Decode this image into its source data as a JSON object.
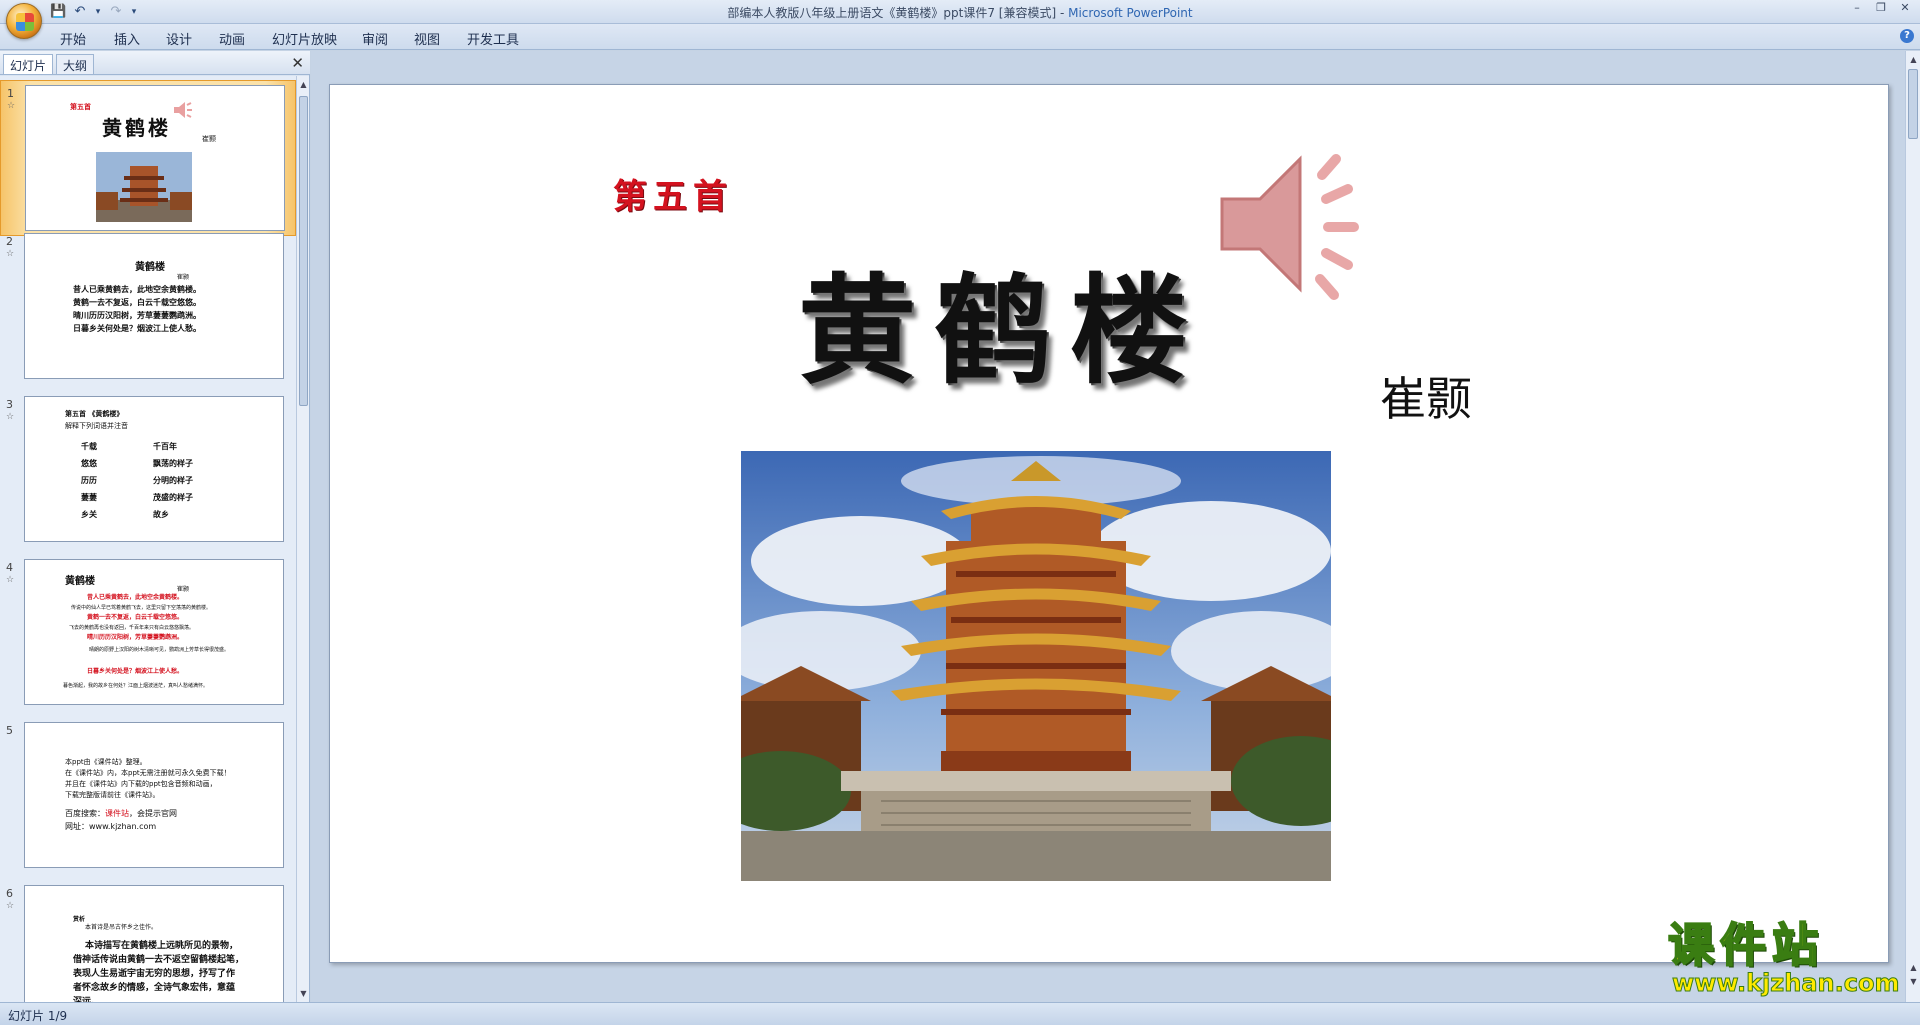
{
  "window": {
    "title": "部编本人教版八年级上册语文《黄鹤楼》ppt课件7 [兼容模式] - ",
    "app_name": "Microsoft PowerPoint"
  },
  "ribbon": {
    "tabs": [
      "开始",
      "插入",
      "设计",
      "动画",
      "幻灯片放映",
      "审阅",
      "视图",
      "开发工具"
    ]
  },
  "left_pane": {
    "tabs": [
      "幻灯片",
      "大纲"
    ],
    "thumbnails": [
      {
        "num": "1",
        "sub": "第五首",
        "title": "黄鹤楼",
        "author": "崔颢"
      },
      {
        "num": "2",
        "title": "黄鹤楼",
        "author": "崔颢",
        "lines": [
          "昔人已乘黄鹤去，此地空余黄鹤楼。",
          "黄鹤一去不复返，白云千载空悠悠。",
          "晴川历历汉阳树，芳草萋萋鹦鹉洲。",
          "日暮乡关何处是？烟波江上使人愁。"
        ]
      },
      {
        "num": "3",
        "header": "第五首 《黄鹤楼》",
        "sub": "解释下列词语并注音",
        "terms": [
          "千载",
          "悠悠",
          "历历",
          "萋萋",
          "乡关"
        ],
        "defs": [
          "千百年",
          "飘荡的样子",
          "分明的样子",
          "茂盛的样子",
          "故乡"
        ]
      },
      {
        "num": "4",
        "title": "黄鹤楼",
        "author": "崔颢",
        "lines": [
          "昔人已乘黄鹤去，此地空余黄鹤楼。",
          "传说中的仙人早已驾着黄鹤飞去，这里只留下空荡荡的黄鹤楼。",
          "黄鹤一去不复返，白云千载空悠悠。",
          "飞去的黄鹤再也没有返回，千百年来只有白云悠悠飘荡。",
          "晴川历历汉阳树，芳草萋萋鹦鹉洲。",
          "晴朗的原野上汉阳的树木清晰可见，鹦鹉洲上芳草长得很茂盛。",
          "日暮乡关何处是？烟波江上使人愁。",
          "暮色渐起，我的故乡在何处？江面上烟波迷茫，真叫人愁绪满怀。"
        ]
      },
      {
        "num": "5",
        "lines": [
          "本ppt由《课件站》整理。",
          "在《课件站》内，本ppt无需注册就可永久免费下载！",
          "并且在《课件站》内下载的ppt包含音频和动画，",
          "下载完整版请前往《课件站》。"
        ],
        "search_label": "百度搜索：",
        "site_name": "课件站",
        "search_suffix": "，会提示官网",
        "url_line": "网址：www.kjzhan.com"
      },
      {
        "num": "6",
        "label": "赏析",
        "lines": [
          "本首诗是吊古怀乡之佳作。",
          "本诗描写在黄鹤楼上远眺所见的景物，",
          "借神话传说由黄鹤一去不返空留鹤楼起笔，",
          "表现人生易逝宇宙无穷的思想，抒写了作",
          "者怀念故乡的情感，全诗气象宏伟，意蕴",
          "深远。"
        ]
      }
    ]
  },
  "slide": {
    "subtitle": "第五首",
    "title": "黄鹤楼",
    "author": "崔颢"
  },
  "watermark": {
    "name": "课件站",
    "url": "www.kjzhan.com"
  },
  "status": {
    "slide_indicator": "幻灯片 1/9"
  },
  "colors": {
    "title_red": "#d4121f",
    "ribbon_bg": "#dfe8f5",
    "selected_thumb": "#fbe2a9",
    "watermark_yellow": "#ffea00"
  }
}
